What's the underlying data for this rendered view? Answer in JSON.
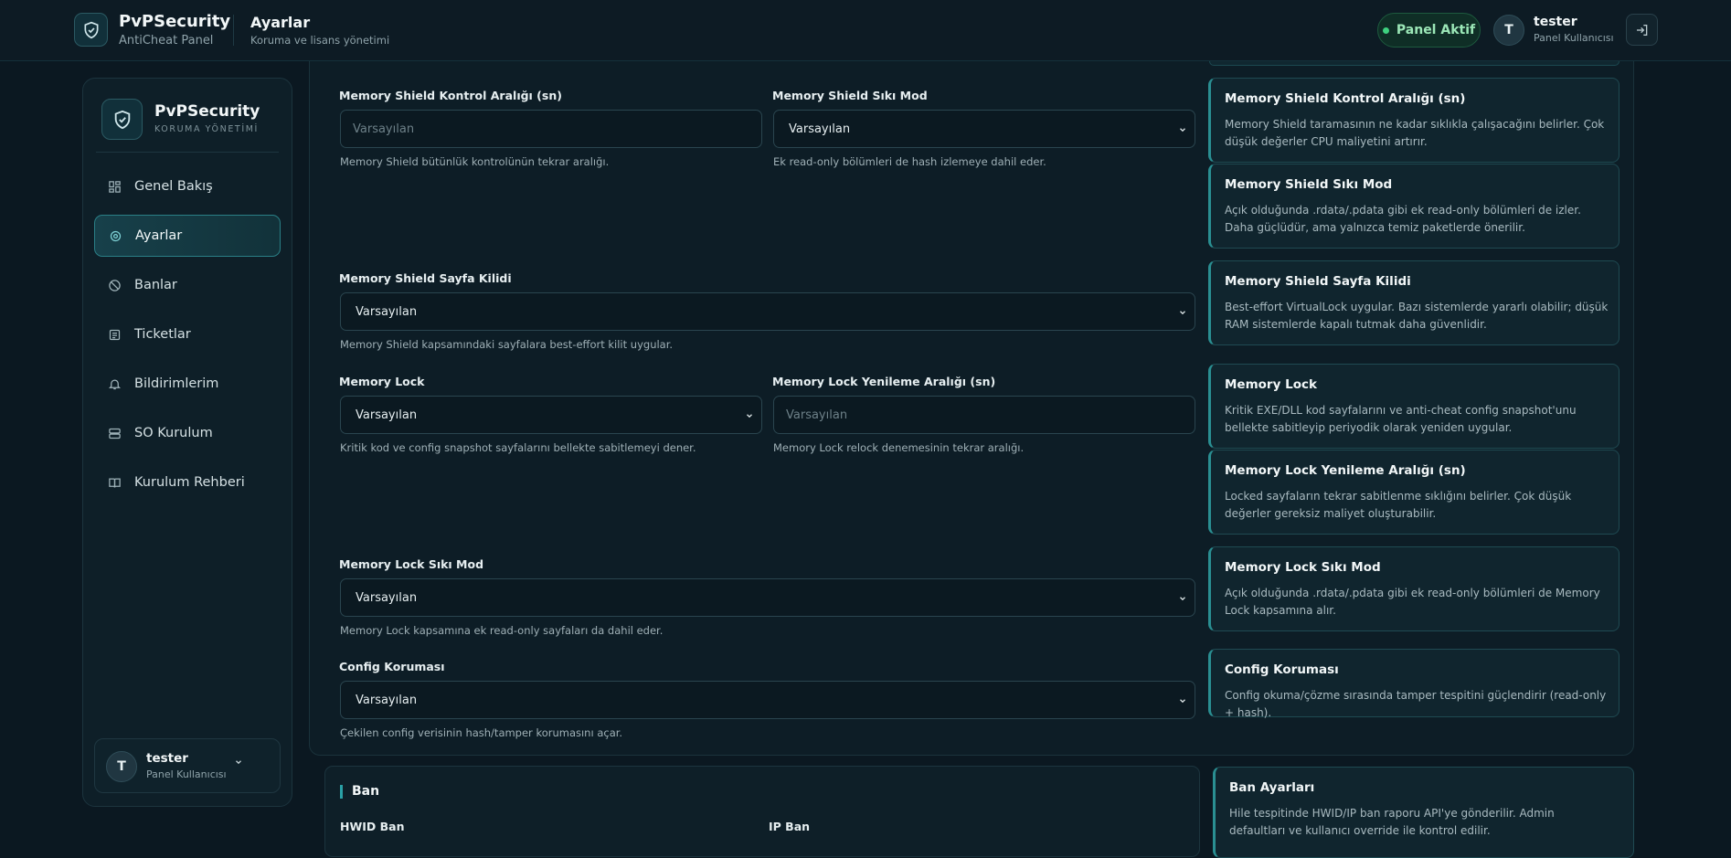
{
  "header": {
    "brand_title": "PvPSecurity",
    "brand_sub": "AntiCheat Panel",
    "page_title": "Ayarlar",
    "page_sub": "Koruma ve lisans yönetimi",
    "status": "Panel Aktif",
    "user_initial": "T",
    "user_name": "tester",
    "user_role": "Panel Kullanıcısı",
    "icons": [
      "shield-icon",
      "logout-icon"
    ]
  },
  "sidebar": {
    "title": "PvPSecurity",
    "subtitle": "KORUMA YÖNETİMİ",
    "items": [
      {
        "label": "Genel Bakış",
        "icon": "grid-icon"
      },
      {
        "label": "Ayarlar",
        "icon": "gear-icon",
        "active": true
      },
      {
        "label": "Banlar",
        "icon": "ban-icon"
      },
      {
        "label": "Ticketlar",
        "icon": "ticket-icon"
      },
      {
        "label": "Bildirimlerim",
        "icon": "bell-icon"
      },
      {
        "label": "SO Kurulum",
        "icon": "server-icon"
      },
      {
        "label": "Kurulum Rehberi",
        "icon": "book-icon"
      }
    ],
    "user_initial": "T",
    "user_name": "tester",
    "user_role": "Panel Kullanıcısı"
  },
  "fields": {
    "ms_interval": {
      "label": "Memory Shield Kontrol Aralığı (sn)",
      "placeholder": "Varsayılan",
      "help": "Memory Shield bütünlük kontrolünün tekrar aralığı."
    },
    "ms_strict": {
      "label": "Memory Shield Sıkı Mod",
      "value": "Varsayılan",
      "help": "Ek read-only bölümleri de hash izlemeye dahil eder."
    },
    "ms_pagelock": {
      "label": "Memory Shield Sayfa Kilidi",
      "value": "Varsayılan",
      "help": "Memory Shield kapsamındaki sayfalara best-effort kilit uygular."
    },
    "ml": {
      "label": "Memory Lock",
      "value": "Varsayılan",
      "help": "Kritik kod ve config snapshot sayfalarını bellekte sabitlemeyi dener."
    },
    "ml_interval": {
      "label": "Memory Lock Yenileme Aralığı (sn)",
      "placeholder": "Varsayılan",
      "help": "Memory Lock relock denemesinin tekrar aralığı."
    },
    "ml_strict": {
      "label": "Memory Lock Sıkı Mod",
      "value": "Varsayılan",
      "help": "Memory Lock kapsamına ek read-only sayfaları da dahil eder."
    },
    "config": {
      "label": "Config Koruması",
      "value": "Varsayılan",
      "help": "Çekilen config verisinin hash/tamper korumasını açar."
    }
  },
  "info_cards": [
    {
      "title": "Memory Shield Kontrol Aralığı (sn)",
      "text": "Memory Shield taramasının ne kadar sıklıkla çalışacağını belirler. Çok düşük değerler CPU maliyetini artırır."
    },
    {
      "title": "Memory Shield Sıkı Mod",
      "text": "Açık olduğunda .rdata/.pdata gibi ek read-only bölümleri de izler. Daha güçlüdür, ama yalnızca temiz paketlerde önerilir."
    },
    {
      "title": "Memory Shield Sayfa Kilidi",
      "text": "Best-effort VirtualLock uygular. Bazı sistemlerde yararlı olabilir; düşük RAM sistemlerde kapalı tutmak daha güvenlidir."
    },
    {
      "title": "Memory Lock",
      "text": "Kritik EXE/DLL kod sayfalarını ve anti-cheat config snapshot'unu bellekte sabitleyip periyodik olarak yeniden uygular."
    },
    {
      "title": "Memory Lock Yenileme Aralığı (sn)",
      "text": "Locked sayfaların tekrar sabitlenme sıklığını belirler. Çok düşük değerler gereksiz maliyet oluşturabilir."
    },
    {
      "title": "Memory Lock Sıkı Mod",
      "text": "Açık olduğunda .rdata/.pdata gibi ek read-only bölümleri de Memory Lock kapsamına alır."
    },
    {
      "title": "Config Koruması",
      "text": "Config okuma/çözme sırasında tamper tespitini güçlendirir (read-only + hash)."
    }
  ],
  "ban": {
    "title": "Ban",
    "hwid_label": "HWID Ban",
    "ip_label": "IP Ban",
    "info_title": "Ban Ayarları",
    "info_text": "Hile tespitinde HWID/IP ban raporu API'ye gönderilir. Admin defaultları ve kullanıcı override ile kontrol edilir."
  },
  "colors": {
    "accent": "#2a8f92",
    "background": "#0b1821",
    "status_green": "#3ed17f"
  }
}
